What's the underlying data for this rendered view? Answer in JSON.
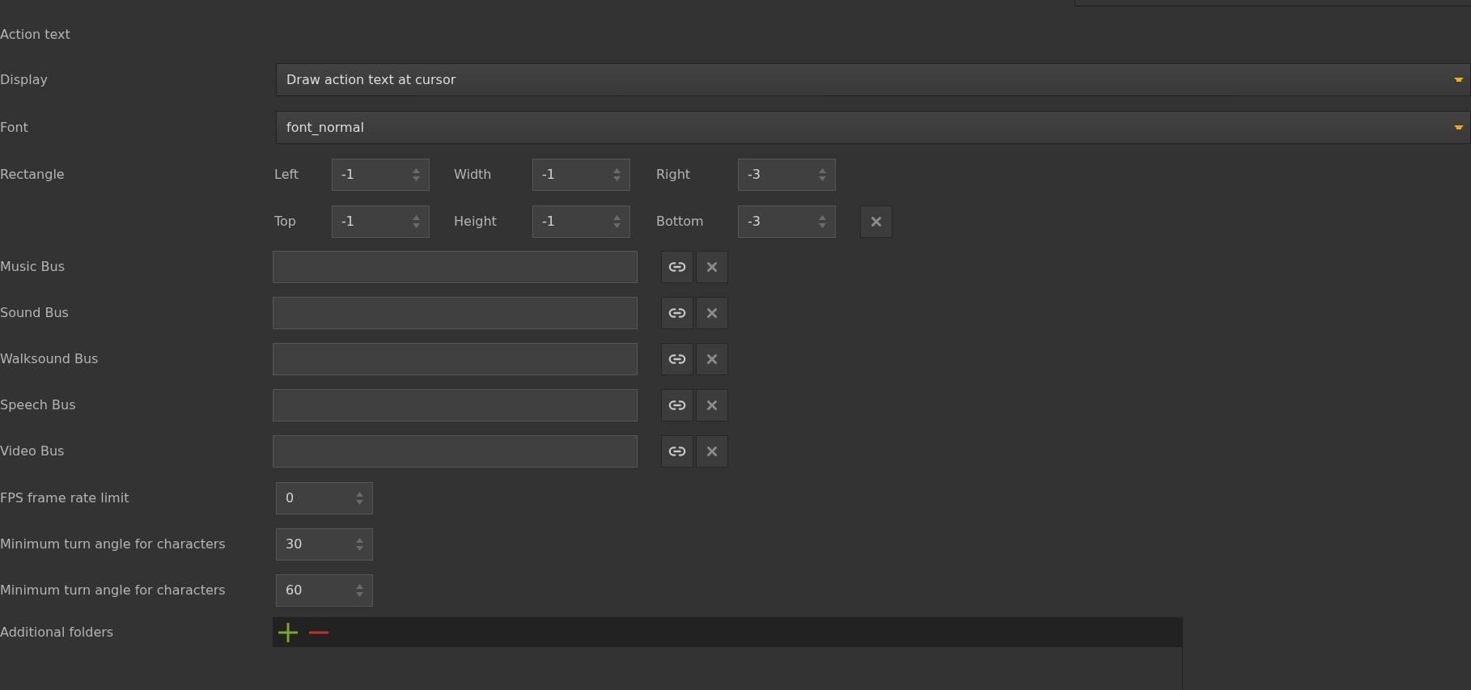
{
  "section_title": "Action text",
  "display": {
    "label": "Display",
    "value": "Draw action text at cursor"
  },
  "font": {
    "label": "Font",
    "value": "font_normal"
  },
  "rectangle": {
    "label": "Rectangle",
    "rows": [
      [
        {
          "label": "Left",
          "value": "-1"
        },
        {
          "label": "Width",
          "value": "-1"
        },
        {
          "label": "Right",
          "value": "-3"
        }
      ],
      [
        {
          "label": "Top",
          "value": "-1"
        },
        {
          "label": "Height",
          "value": "-1"
        },
        {
          "label": "Bottom",
          "value": "-3"
        }
      ]
    ]
  },
  "buses": [
    {
      "label": "Music Bus"
    },
    {
      "label": "Sound Bus"
    },
    {
      "label": "Walksound Bus"
    },
    {
      "label": "Speech Bus"
    },
    {
      "label": "Video Bus"
    }
  ],
  "spinners": [
    {
      "label": "FPS frame rate limit",
      "value": "0"
    },
    {
      "label": "Minimum turn angle for characters",
      "value": "30"
    },
    {
      "label": "Minimum turn angle for characters",
      "value": "60"
    }
  ],
  "additional_folders": {
    "label": "Additional folders"
  }
}
